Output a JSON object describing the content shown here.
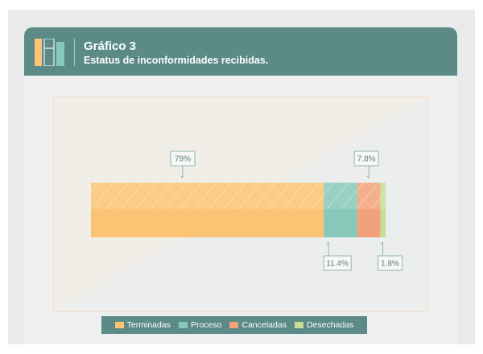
{
  "header": {
    "title": "Gráfico 3",
    "subtitle": "Estatus de inconformidades recibidas."
  },
  "chart_data": {
    "type": "bar",
    "orientation": "horizontal-stacked",
    "title": "Gráfico 3",
    "subtitle": "Estatus de inconformidades recibidas.",
    "unit": "%",
    "series": [
      {
        "name": "Terminadas",
        "value": 79,
        "label": "79%",
        "color": "#fbc474"
      },
      {
        "name": "Proceso",
        "value": 11.4,
        "label": "11.4%",
        "color": "#86c9b9"
      },
      {
        "name": "Canceladas",
        "value": 7.8,
        "label": "7.8%",
        "color": "#f2a27a"
      },
      {
        "name": "Desechadas",
        "value": 1.8,
        "label": "1.8%",
        "color": "#c5dd94"
      }
    ],
    "label_placement": [
      "above",
      "below",
      "above",
      "below"
    ],
    "legend_placement": "bottom",
    "grid": false
  },
  "colors": {
    "header_bg": "#5b8a87",
    "plot_bg": "#f1ede7",
    "label_border": "#7aa6a2",
    "label_text": "#5f7c79"
  },
  "icons": {
    "logo": "bar-chart-logo-icon",
    "legend_marker": "tag-icon"
  }
}
